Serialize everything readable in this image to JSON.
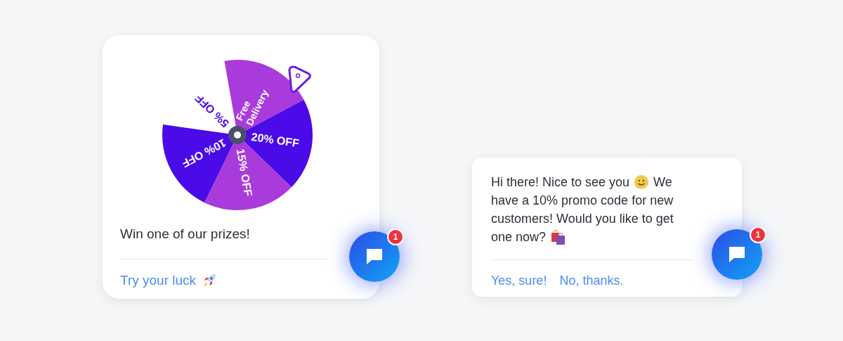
{
  "wheel_widget": {
    "segments": [
      {
        "lines": [
          "5% OFF"
        ],
        "color": "#4b0ae8",
        "kind": "blank"
      },
      {
        "lines": [
          "Free",
          "Delivery"
        ],
        "color": "#a93bdc",
        "kind": "filled"
      },
      {
        "lines": [
          "20% OFF"
        ],
        "color": "#4b0ae8",
        "kind": "filled"
      },
      {
        "lines": [
          "15% OFF"
        ],
        "color": "#a93bdc",
        "kind": "filled"
      },
      {
        "lines": [
          "10% OFF"
        ],
        "color": "#4b0ae8",
        "kind": "filled"
      }
    ],
    "message": "Win one of our prizes!",
    "action": "Try your luck",
    "badge": "1"
  },
  "promo_widget": {
    "message_lines": [
      "Hi there! Nice to see you",
      "We",
      "have a 10% promo code for new",
      "customers! Would you like to get",
      "one now?"
    ],
    "actions": [
      "Yes, sure!",
      "No, thanks."
    ],
    "badge": "1"
  }
}
